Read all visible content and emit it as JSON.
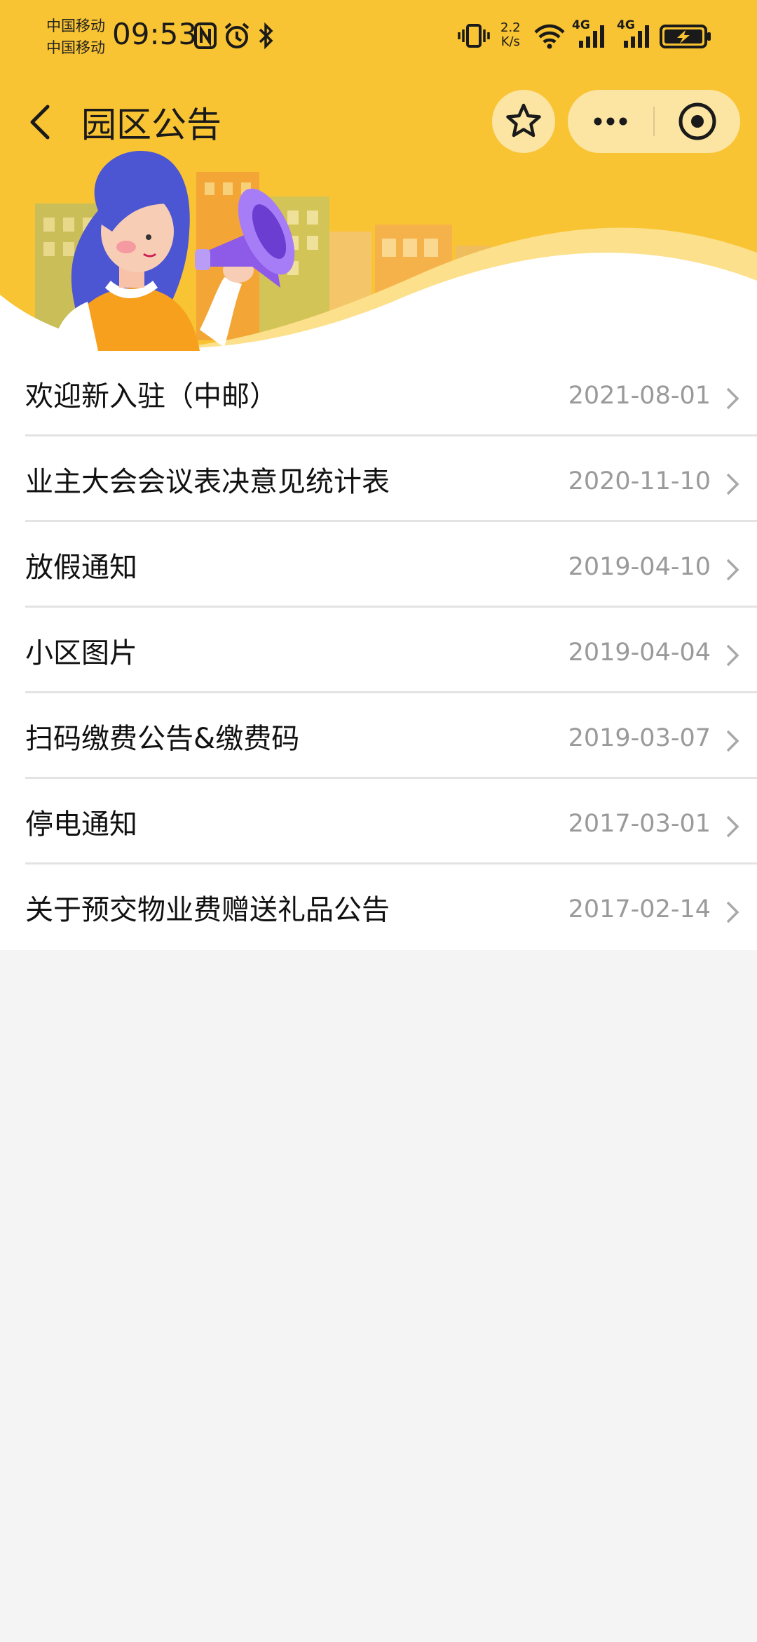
{
  "status_bar": {
    "carrier_1": "中国移动",
    "carrier_2": "中国移动",
    "time": "09:53",
    "net_speed_value": "2.2",
    "net_speed_unit": "K/s",
    "network_1": "4G",
    "network_2": "4G",
    "icons": [
      "nfc-icon",
      "alarm-icon",
      "bluetooth-icon",
      "vibrate-icon",
      "wifi-icon",
      "signal-icon",
      "battery-charging-icon"
    ]
  },
  "nav": {
    "title": "园区公告",
    "icons": [
      "back-arrow-icon",
      "star-icon",
      "more-dots-icon",
      "target-close-icon"
    ]
  },
  "banner": {
    "illustration": "woman-with-megaphone"
  },
  "announcements": [
    {
      "title": "欢迎新入驻（中邮）",
      "date": "2021-08-01"
    },
    {
      "title": "业主大会会议表决意见统计表",
      "date": "2020-11-10"
    },
    {
      "title": "放假通知",
      "date": "2019-04-10"
    },
    {
      "title": "小区图片",
      "date": "2019-04-04"
    },
    {
      "title": "扫码缴费公告&缴费码",
      "date": "2019-03-07"
    },
    {
      "title": "停电通知",
      "date": "2017-03-01"
    },
    {
      "title": "关于预交物业费赠送礼品公告",
      "date": "2017-02-14"
    }
  ],
  "colors": {
    "brand_yellow": "#f9c433",
    "page_background": "#f4f4f4",
    "date_gray": "#9a9a9a"
  }
}
